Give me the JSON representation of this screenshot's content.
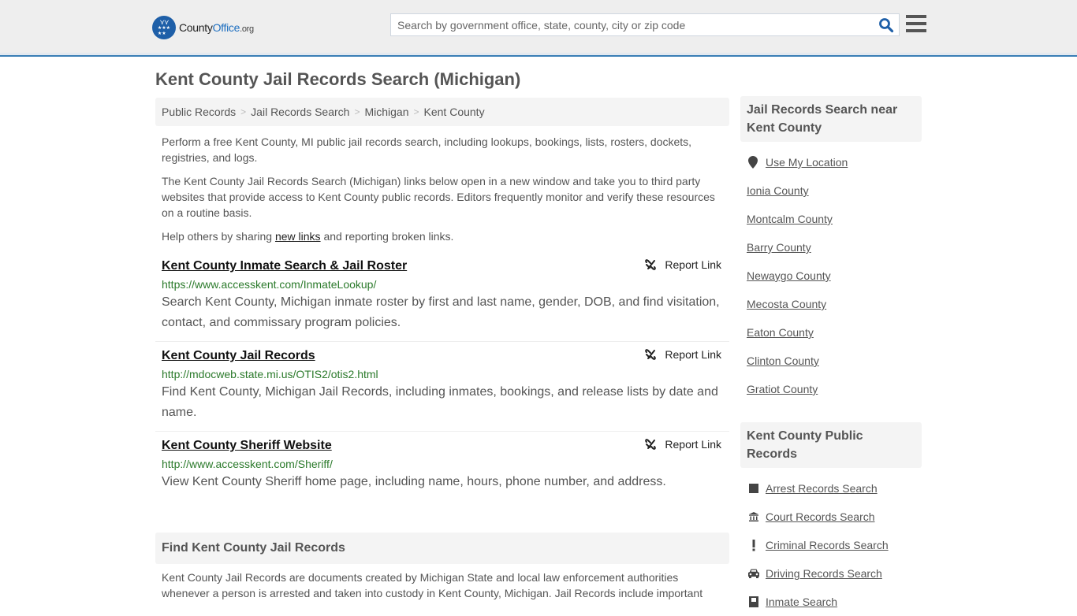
{
  "header": {
    "logo": {
      "name": "County",
      "name_accent": "Office",
      "tld": ".org"
    },
    "search_placeholder": "Search by government office, state, county, city or zip code",
    "search_value": ""
  },
  "colors": {
    "accent": "#3a7eb5",
    "logo_blue": "#1e5fa8",
    "url_green": "#2b7a2b",
    "panel_bg": "#f4f4f4"
  },
  "page_title": "Kent County Jail Records Search (Michigan)",
  "breadcrumb": [
    "Public Records",
    "Jail Records Search",
    "Michigan",
    "Kent County"
  ],
  "breadcrumb_sep": ">",
  "intro": {
    "p1": "Perform a free Kent County, MI public jail records search, including lookups, bookings, lists, rosters, dockets, registries, and logs.",
    "p2": "The Kent County Jail Records Search (Michigan) links below open in a new window and take you to third party websites that provide access to Kent County public records. Editors frequently monitor and verify these resources on a routine basis.",
    "p3_before": "Help others by sharing ",
    "p3_link": "new links",
    "p3_after": " and reporting broken links."
  },
  "results": [
    {
      "title": "Kent County Inmate Search & Jail Roster",
      "url": "https://www.accesskent.com/InmateLookup/",
      "description": "Search Kent County, Michigan inmate roster by first and last name, gender, DOB, and find visitation, contact, and commissary program policies.",
      "report_label": "Report Link"
    },
    {
      "title": "Kent County Jail Records",
      "url": "http://mdocweb.state.mi.us/OTIS2/otis2.html",
      "description": "Find Kent County, Michigan Jail Records, including inmates, bookings, and release lists by date and name.",
      "report_label": "Report Link"
    },
    {
      "title": "Kent County Sheriff Website",
      "url": "http://www.accesskent.com/Sheriff/",
      "description": "View Kent County Sheriff home page, including name, hours, phone number, and address.",
      "report_label": "Report Link"
    }
  ],
  "find_section": {
    "heading": "Find Kent County Jail Records",
    "text": "Kent County Jail Records are documents created by Michigan State and local law enforcement authorities whenever a person is arrested and taken into custody in Kent County, Michigan. Jail Records include important"
  },
  "sidebar": {
    "nearby": {
      "heading": "Jail Records Search near Kent County",
      "use_location": "Use My Location",
      "items": [
        "Ionia County",
        "Montcalm County",
        "Barry County",
        "Newaygo County",
        "Mecosta County",
        "Eaton County",
        "Clinton County",
        "Gratiot County"
      ]
    },
    "public_records": {
      "heading": "Kent County Public Records",
      "items": [
        {
          "label": "Arrest Records Search",
          "icon": "square-icon"
        },
        {
          "label": "Court Records Search",
          "icon": "courthouse-icon"
        },
        {
          "label": "Criminal Records Search",
          "icon": "exclamation-icon"
        },
        {
          "label": "Driving Records Search",
          "icon": "car-icon"
        },
        {
          "label": "Inmate Search",
          "icon": "id-badge-icon"
        }
      ]
    }
  }
}
